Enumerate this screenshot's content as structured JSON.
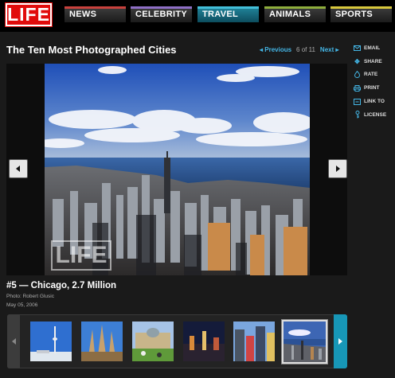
{
  "logo": "LIFE",
  "nav": [
    {
      "label": "NEWS",
      "color": "#c9413d"
    },
    {
      "label": "CELEBRITY",
      "color": "#8f6fc6"
    },
    {
      "label": "TRAVEL",
      "color": "#43bfd9",
      "active": true
    },
    {
      "label": "ANIMALS",
      "color": "#8fae3c"
    },
    {
      "label": "SPORTS",
      "color": "#d8c83c"
    }
  ],
  "gallery": {
    "title": "The Ten Most Photographed Cities",
    "previous": "Previous",
    "counter": "6 of 11",
    "next": "Next"
  },
  "actions": [
    {
      "label": "EMAIL",
      "icon": "envelope-icon"
    },
    {
      "label": "SHARE",
      "icon": "share-icon"
    },
    {
      "label": "RATE",
      "icon": "flame-icon"
    },
    {
      "label": "PRINT",
      "icon": "printer-icon"
    },
    {
      "label": "LINK TO",
      "icon": "link-icon"
    },
    {
      "label": "LICENSE",
      "icon": "key-icon"
    }
  ],
  "photo": {
    "caption": "#5 — Chicago, 2.7 Million",
    "credit": "Photo: Robert Glusic",
    "date": "May 05, 2006",
    "watermark": "LIFE"
  },
  "filmstrip": {
    "thumbnails": [
      "Toronto",
      "Barcelona",
      "Berlin",
      "Las Vegas",
      "New York",
      "Chicago"
    ],
    "selected_index": 5
  }
}
